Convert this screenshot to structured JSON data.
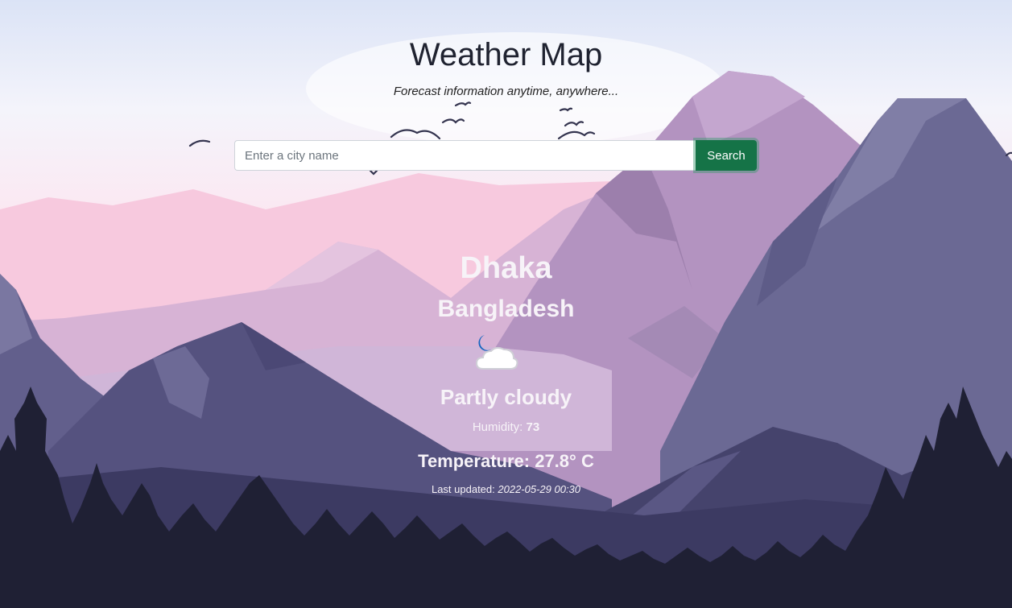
{
  "header": {
    "title": "Weather Map",
    "subtitle": "Forecast information anytime, anywhere..."
  },
  "search": {
    "placeholder": "Enter a city name",
    "button_label": "Search"
  },
  "weather": {
    "city": "Dhaka",
    "country": "Bangladesh",
    "icon": "partly-cloudy-night-icon",
    "condition": "Partly cloudy",
    "humidity_label": "Humidity:",
    "humidity_value": "73",
    "temperature": "Temperature: 27.8° C",
    "updated_label": "Last updated:",
    "updated_value": "2022-05-29 00:30"
  },
  "colors": {
    "button": "#157347",
    "title": "#1f2230",
    "light_text": "#f7f3f8",
    "moon": "#1565c0"
  }
}
